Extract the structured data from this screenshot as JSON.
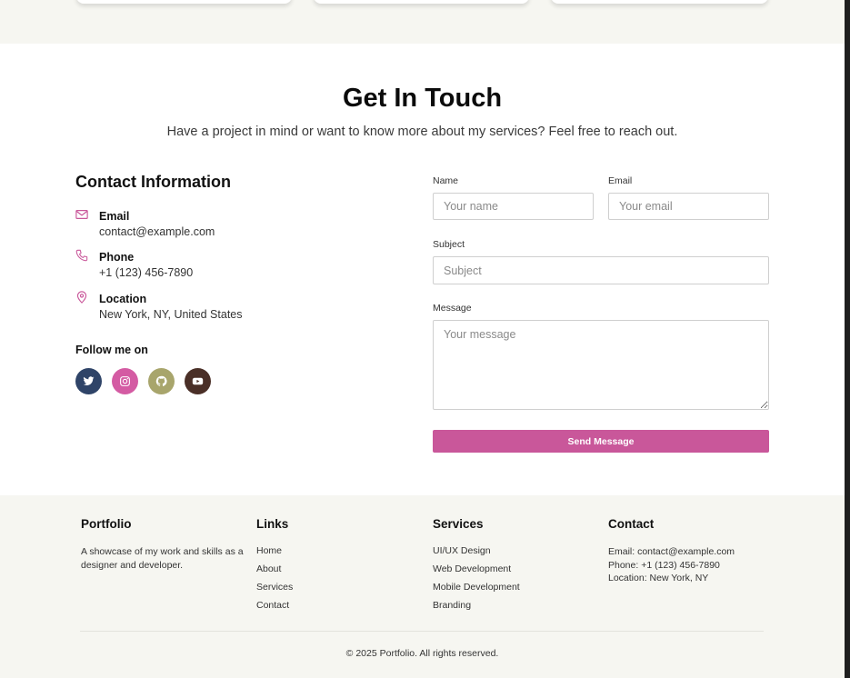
{
  "contact": {
    "title": "Get In Touch",
    "subtitle": "Have a project in mind or want to know more about my services? Feel free to reach out.",
    "info_title": "Contact Information",
    "items": [
      {
        "label": "Email",
        "value": "contact@example.com",
        "icon": "mail-icon"
      },
      {
        "label": "Phone",
        "value": "+1 (123) 456-7890",
        "icon": "phone-icon"
      },
      {
        "label": "Location",
        "value": "New York, NY, United States",
        "icon": "map-pin-icon"
      }
    ],
    "follow_label": "Follow me on",
    "social": [
      {
        "icon": "twitter-icon",
        "color": "#2f4468"
      },
      {
        "icon": "instagram-icon",
        "color": "#d45ba3"
      },
      {
        "icon": "github-icon",
        "color": "#a8a56c"
      },
      {
        "icon": "youtube-icon",
        "color": "#4a2f27"
      }
    ]
  },
  "form": {
    "name_label": "Name",
    "name_placeholder": "Your name",
    "email_label": "Email",
    "email_placeholder": "Your email",
    "subject_label": "Subject",
    "subject_placeholder": "Subject",
    "message_label": "Message",
    "message_placeholder": "Your message",
    "submit_label": "Send Message",
    "accent": "#c9579a"
  },
  "footer": {
    "brand": {
      "title": "Portfolio",
      "text": "A showcase of my work and skills as a designer and developer."
    },
    "links": {
      "title": "Links",
      "items": [
        "Home",
        "About",
        "Services",
        "Contact"
      ]
    },
    "services": {
      "title": "Services",
      "items": [
        "UI/UX Design",
        "Web Development",
        "Mobile Development",
        "Branding"
      ]
    },
    "contact": {
      "title": "Contact",
      "lines": [
        "Email: contact@example.com",
        "Phone: +1 (123) 456-7890",
        "Location: New York, NY"
      ]
    },
    "copyright": "© 2025 Portfolio. All rights reserved."
  }
}
